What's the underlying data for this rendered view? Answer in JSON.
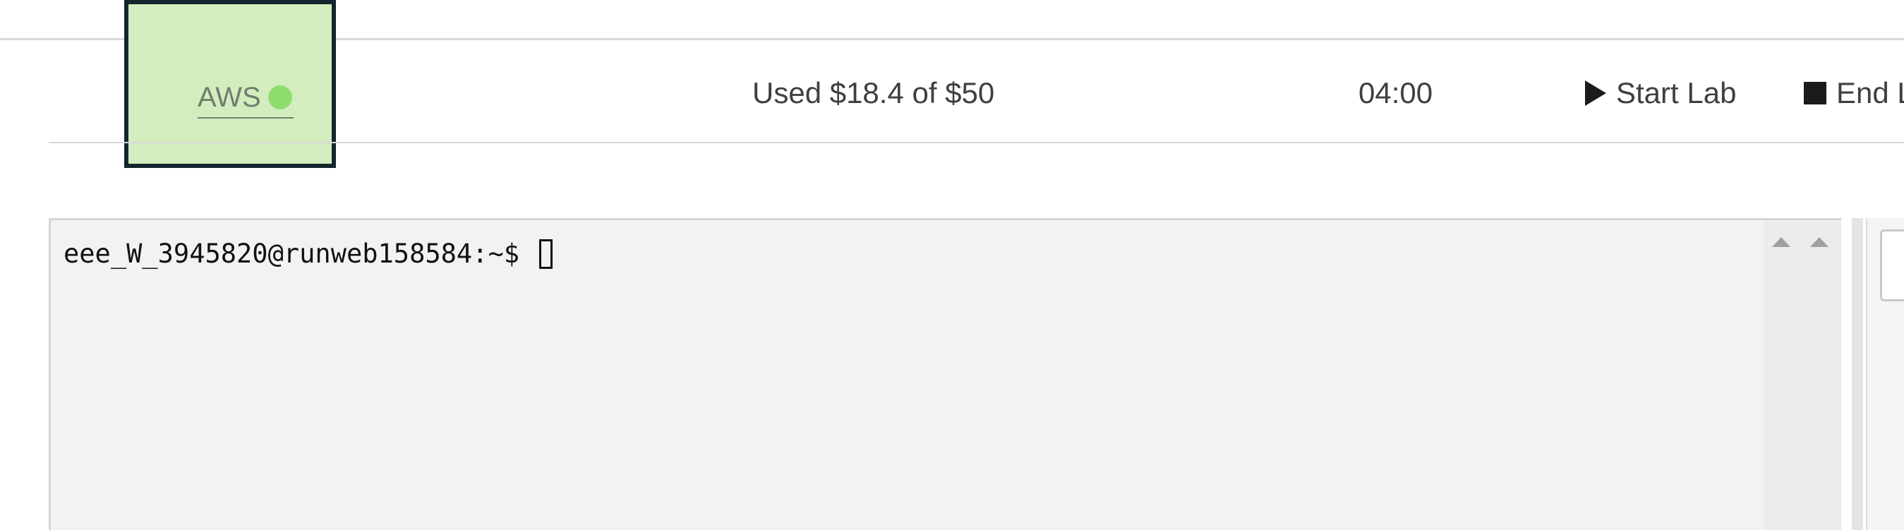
{
  "header": {
    "aws_link_label": "AWS",
    "aws_status_color": "#8fdd6e",
    "highlight_color": "#d3edbe",
    "budget_text": "Used $18.4 of $50",
    "timer_text": "04:00",
    "start_lab_label": "Start Lab",
    "end_lab_label": "End Lab"
  },
  "terminal": {
    "prompt": "eee_W_3945820@runweb158584:~$ "
  },
  "icons": {
    "start": "play-icon",
    "end": "stop-icon",
    "status": "status-dot-icon"
  }
}
